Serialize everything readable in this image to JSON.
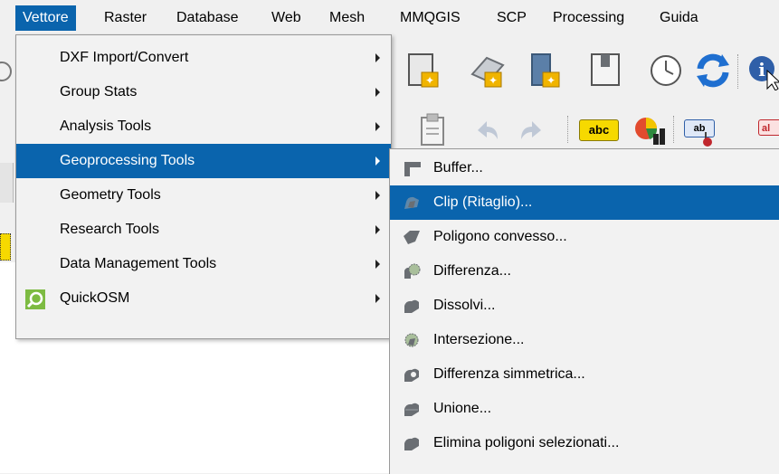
{
  "menubar": {
    "items": [
      {
        "label": "Vettore"
      },
      {
        "label": "Raster"
      },
      {
        "label": "Database"
      },
      {
        "label": "Web"
      },
      {
        "label": "Mesh"
      },
      {
        "label": "MMQGIS"
      },
      {
        "label": "SCP"
      },
      {
        "label": "Processing"
      },
      {
        "label": "Guida"
      }
    ]
  },
  "vettore_menu": {
    "items": [
      {
        "label": "DXF Import/Convert"
      },
      {
        "label": "Group Stats"
      },
      {
        "label": "Analysis Tools"
      },
      {
        "label": "Geoprocessing Tools"
      },
      {
        "label": "Geometry Tools"
      },
      {
        "label": "Research Tools"
      },
      {
        "label": "Data Management Tools"
      },
      {
        "label": "QuickOSM"
      }
    ]
  },
  "geoprocessing_submenu": {
    "items": [
      {
        "label": "Buffer..."
      },
      {
        "label": "Clip (Ritaglio)..."
      },
      {
        "label": "Poligono convesso..."
      },
      {
        "label": "Differenza..."
      },
      {
        "label": "Dissolvi..."
      },
      {
        "label": "Intersezione..."
      },
      {
        "label": "Differenza simmetrica..."
      },
      {
        "label": "Unione..."
      },
      {
        "label": "Elimina poligoni selezionati..."
      }
    ]
  },
  "toolbar": {
    "abc_label": "abc",
    "ab_label": "ab",
    "edge_label": "al"
  },
  "colors": {
    "highlight": "#0a64ad",
    "menu_bg": "#f2f2f2",
    "icon_gray": "#6a6e73"
  }
}
